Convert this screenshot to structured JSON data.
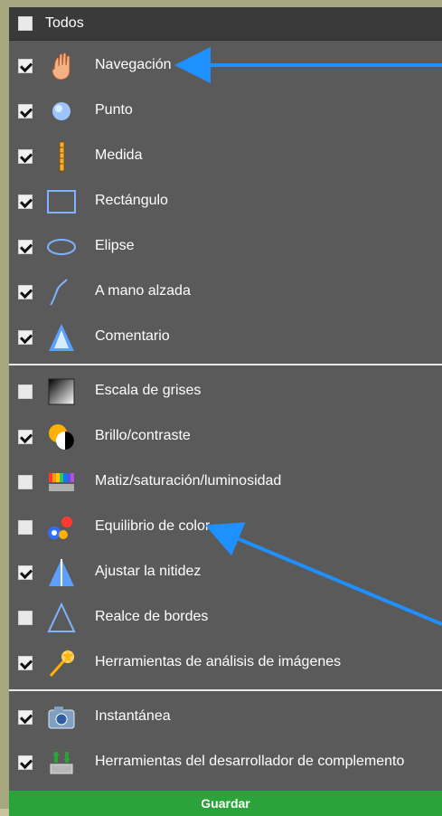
{
  "header": {
    "title": "Todos"
  },
  "groups": [
    {
      "items": [
        {
          "label": "Navegación",
          "checked": true,
          "icon": "hand-icon"
        },
        {
          "label": "Punto",
          "checked": true,
          "icon": "point-icon"
        },
        {
          "label": "Medida",
          "checked": true,
          "icon": "ruler-icon"
        },
        {
          "label": "Rectángulo",
          "checked": true,
          "icon": "rectangle-icon"
        },
        {
          "label": "Elipse",
          "checked": true,
          "icon": "ellipse-icon"
        },
        {
          "label": "A mano alzada",
          "checked": true,
          "icon": "freehand-icon"
        },
        {
          "label": "Comentario",
          "checked": true,
          "icon": "comment-icon"
        }
      ]
    },
    {
      "items": [
        {
          "label": "Escala de grises",
          "checked": false,
          "icon": "grayscale-icon"
        },
        {
          "label": "Brillo/contraste",
          "checked": true,
          "icon": "brightness-contrast-icon"
        },
        {
          "label": "Matiz/saturación/luminosidad",
          "checked": false,
          "icon": "hue-saturation-icon"
        },
        {
          "label": "Equilibrio de color",
          "checked": false,
          "icon": "color-balance-icon"
        },
        {
          "label": "Ajustar la nitidez",
          "checked": true,
          "icon": "sharpen-icon"
        },
        {
          "label": "Realce de bordes",
          "checked": false,
          "icon": "edge-enhance-icon"
        },
        {
          "label": "Herramientas de análisis de imágenes",
          "checked": true,
          "icon": "image-analysis-icon"
        }
      ]
    },
    {
      "items": [
        {
          "label": "Instantánea",
          "checked": true,
          "icon": "snapshot-icon"
        },
        {
          "label": "Herramientas del desarrollador de complemento",
          "checked": true,
          "icon": "developer-tools-icon"
        }
      ]
    }
  ],
  "footer": {
    "save_label": "Guardar"
  },
  "colors": {
    "panel": "#5a5a5a",
    "header": "#3a3a3a",
    "accent_green": "#2aa33a",
    "arrow_blue": "#1e90ff"
  }
}
